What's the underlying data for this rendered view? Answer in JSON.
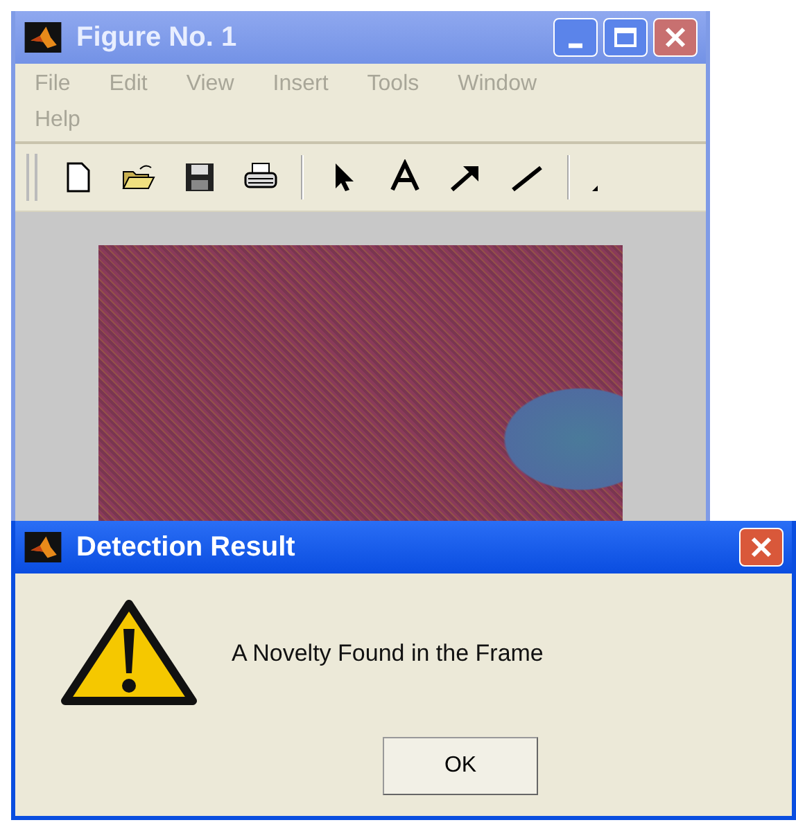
{
  "figure_window": {
    "title": "Figure No. 1",
    "menu": [
      "File",
      "Edit",
      "View",
      "Insert",
      "Tools",
      "Window",
      "Help"
    ]
  },
  "dialog": {
    "title": "Detection Result",
    "message": "A Novelty Found in the Frame",
    "buttons": [
      "OK"
    ]
  }
}
